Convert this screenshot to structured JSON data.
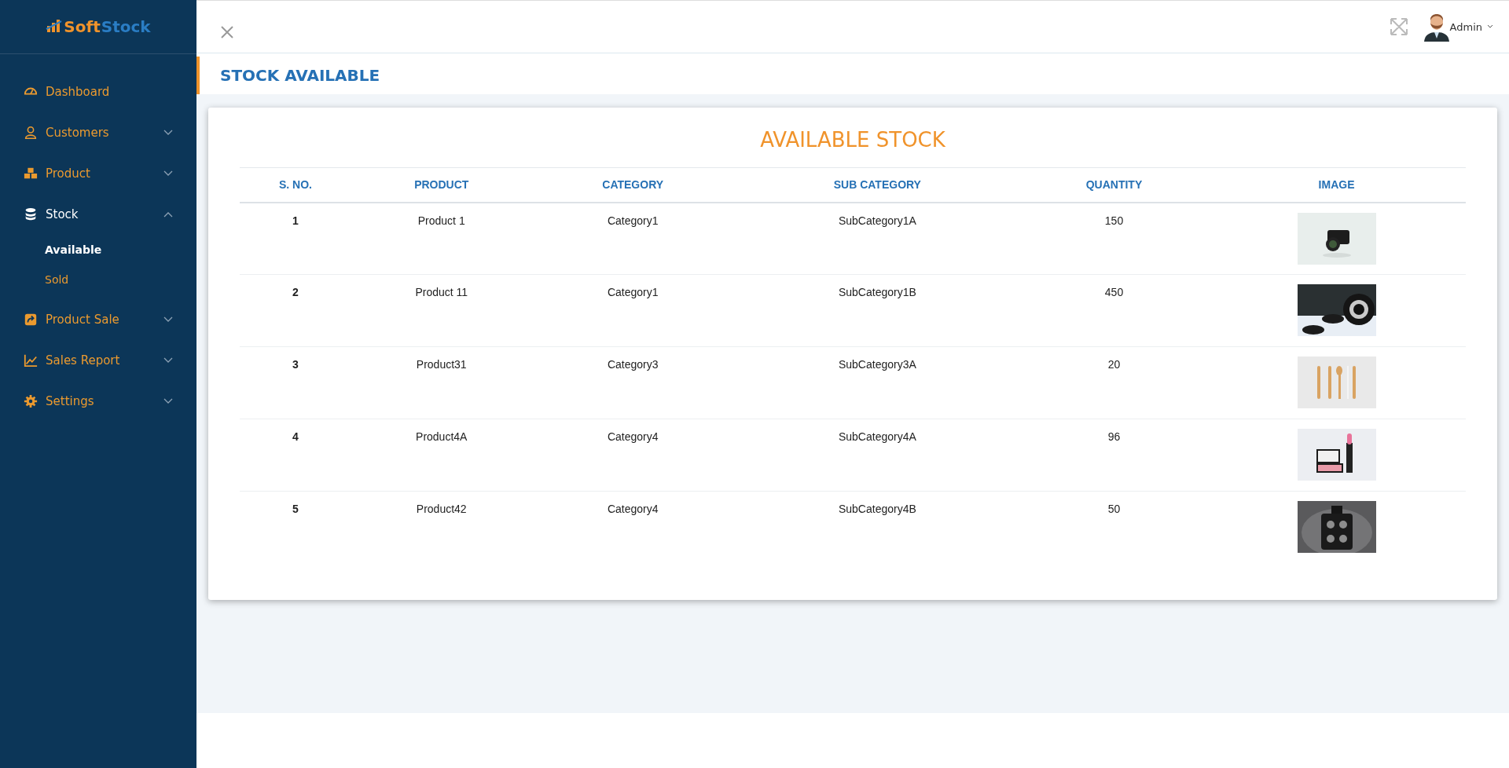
{
  "brand": {
    "first": "Soft",
    "second": "Stock"
  },
  "sidebar": {
    "items": [
      {
        "label": "Dashboard",
        "selected": false
      },
      {
        "label": "Customers",
        "selected": false,
        "expanded": false
      },
      {
        "label": "Product",
        "selected": false,
        "expanded": false
      },
      {
        "label": "Stock",
        "selected": true,
        "expanded": true,
        "children": [
          {
            "label": "Available",
            "selected": true
          },
          {
            "label": "Sold",
            "selected": false
          }
        ]
      },
      {
        "label": "Product Sale",
        "selected": false,
        "expanded": false
      },
      {
        "label": "Sales Report",
        "selected": false,
        "expanded": false
      },
      {
        "label": "Settings",
        "selected": false,
        "expanded": false
      }
    ]
  },
  "header": {
    "user": "Admin"
  },
  "page_title": "STOCK AVAILABLE",
  "card": {
    "title": "AVAILABLE STOCK",
    "table": {
      "columns": [
        "S. NO.",
        "PRODUCT",
        "CATEGORY",
        "SUB CATEGORY",
        "QUANTITY",
        "IMAGE"
      ],
      "rows": [
        {
          "sno": "1",
          "product": "Product 1",
          "category": "Category1",
          "sub_category": "SubCategory1A",
          "quantity": "150"
        },
        {
          "sno": "2",
          "product": "Product 11",
          "category": "Category1",
          "sub_category": "SubCategory1B",
          "quantity": "450"
        },
        {
          "sno": "3",
          "product": "Product31",
          "category": "Category3",
          "sub_category": "SubCategory3A",
          "quantity": "20"
        },
        {
          "sno": "4",
          "product": "Product4A",
          "category": "Category4",
          "sub_category": "SubCategory4A",
          "quantity": "96"
        },
        {
          "sno": "5",
          "product": "Product42",
          "category": "Category4",
          "sub_category": "SubCategory4B",
          "quantity": "50"
        }
      ]
    }
  }
}
